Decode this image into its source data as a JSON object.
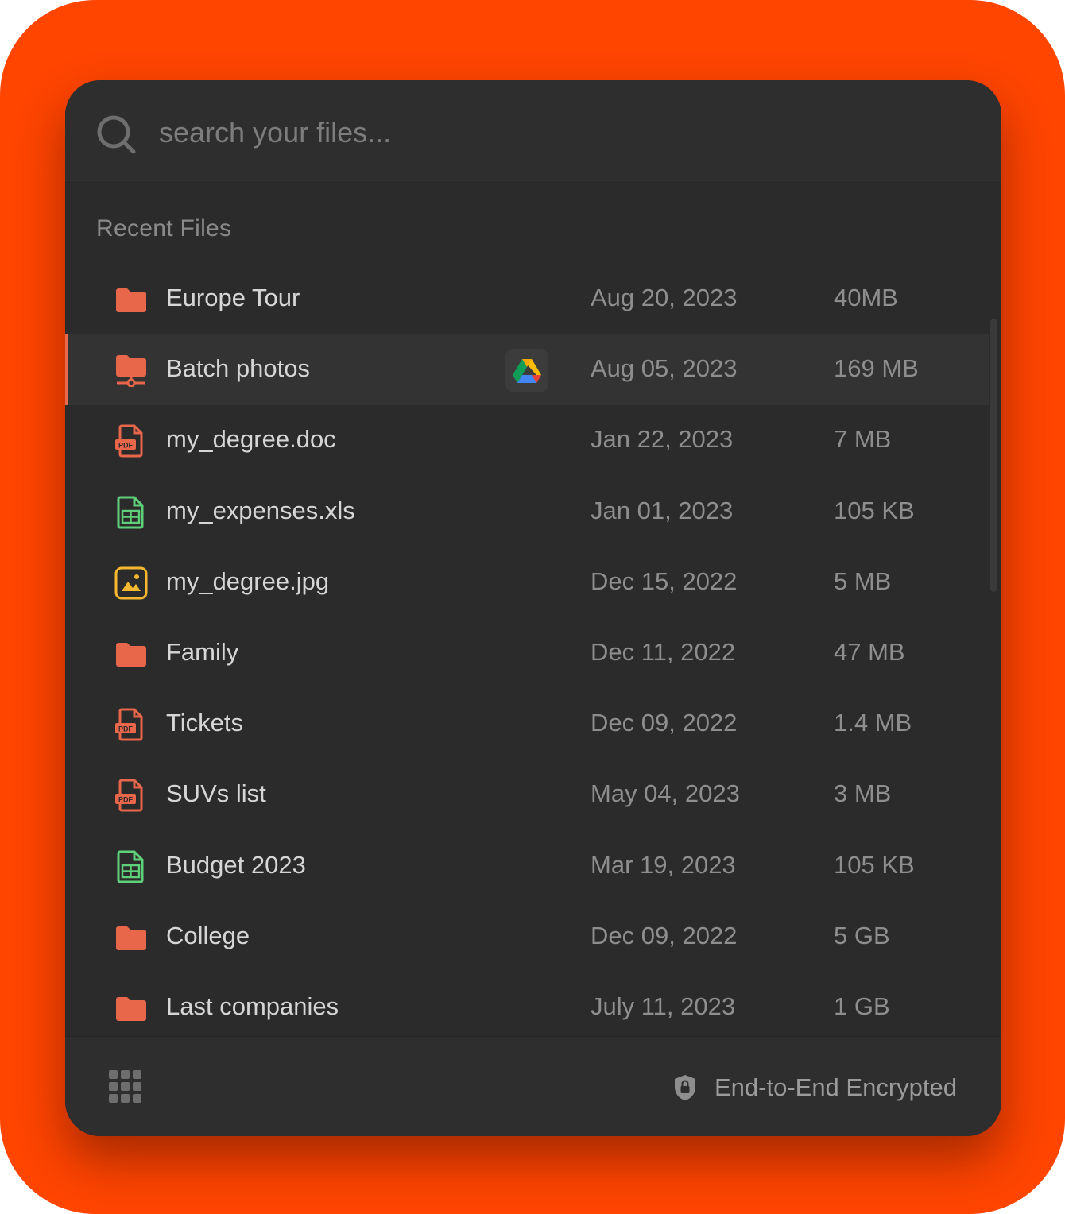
{
  "search": {
    "placeholder": "search your files..."
  },
  "section": {
    "title": "Recent Files"
  },
  "colors": {
    "background": "#FF4500",
    "panel": "#2B2B2B",
    "folder": "#E8664A",
    "pdf": "#E8664A",
    "sheet": "#5FD07A",
    "image": "#F5B82E",
    "active_row": "#333333"
  },
  "files": [
    {
      "name": "Europe Tour",
      "date": "Aug 20, 2023",
      "size": "40MB",
      "icon": "folder-icon"
    },
    {
      "name": "Batch photos",
      "date": "Aug 05, 2023",
      "size": "169 MB",
      "icon": "shared-folder-icon",
      "active": true,
      "badge": "google-drive-icon"
    },
    {
      "name": "my_degree.doc",
      "date": "Jan 22, 2023",
      "size": "7 MB",
      "icon": "pdf-file-icon"
    },
    {
      "name": "my_expenses.xls",
      "date": "Jan 01, 2023",
      "size": "105 KB",
      "icon": "spreadsheet-file-icon"
    },
    {
      "name": "my_degree.jpg",
      "date": "Dec 15, 2022",
      "size": "5 MB",
      "icon": "image-file-icon"
    },
    {
      "name": "Family",
      "date": "Dec 11, 2022",
      "size": "47 MB",
      "icon": "folder-icon"
    },
    {
      "name": "Tickets",
      "date": "Dec 09, 2022",
      "size": "1.4 MB",
      "icon": "pdf-file-icon"
    },
    {
      "name": "SUVs list",
      "date": "May 04, 2023",
      "size": "3 MB",
      "icon": "pdf-file-icon"
    },
    {
      "name": "Budget 2023",
      "date": "Mar 19, 2023",
      "size": "105 KB",
      "icon": "spreadsheet-file-icon"
    },
    {
      "name": "College",
      "date": "Dec 09, 2022",
      "size": "5 GB",
      "icon": "folder-icon"
    },
    {
      "name": "Last companies",
      "date": "July 11, 2023",
      "size": "1 GB",
      "icon": "folder-icon"
    }
  ],
  "footer": {
    "encryption_label": "End-to-End Encrypted"
  }
}
